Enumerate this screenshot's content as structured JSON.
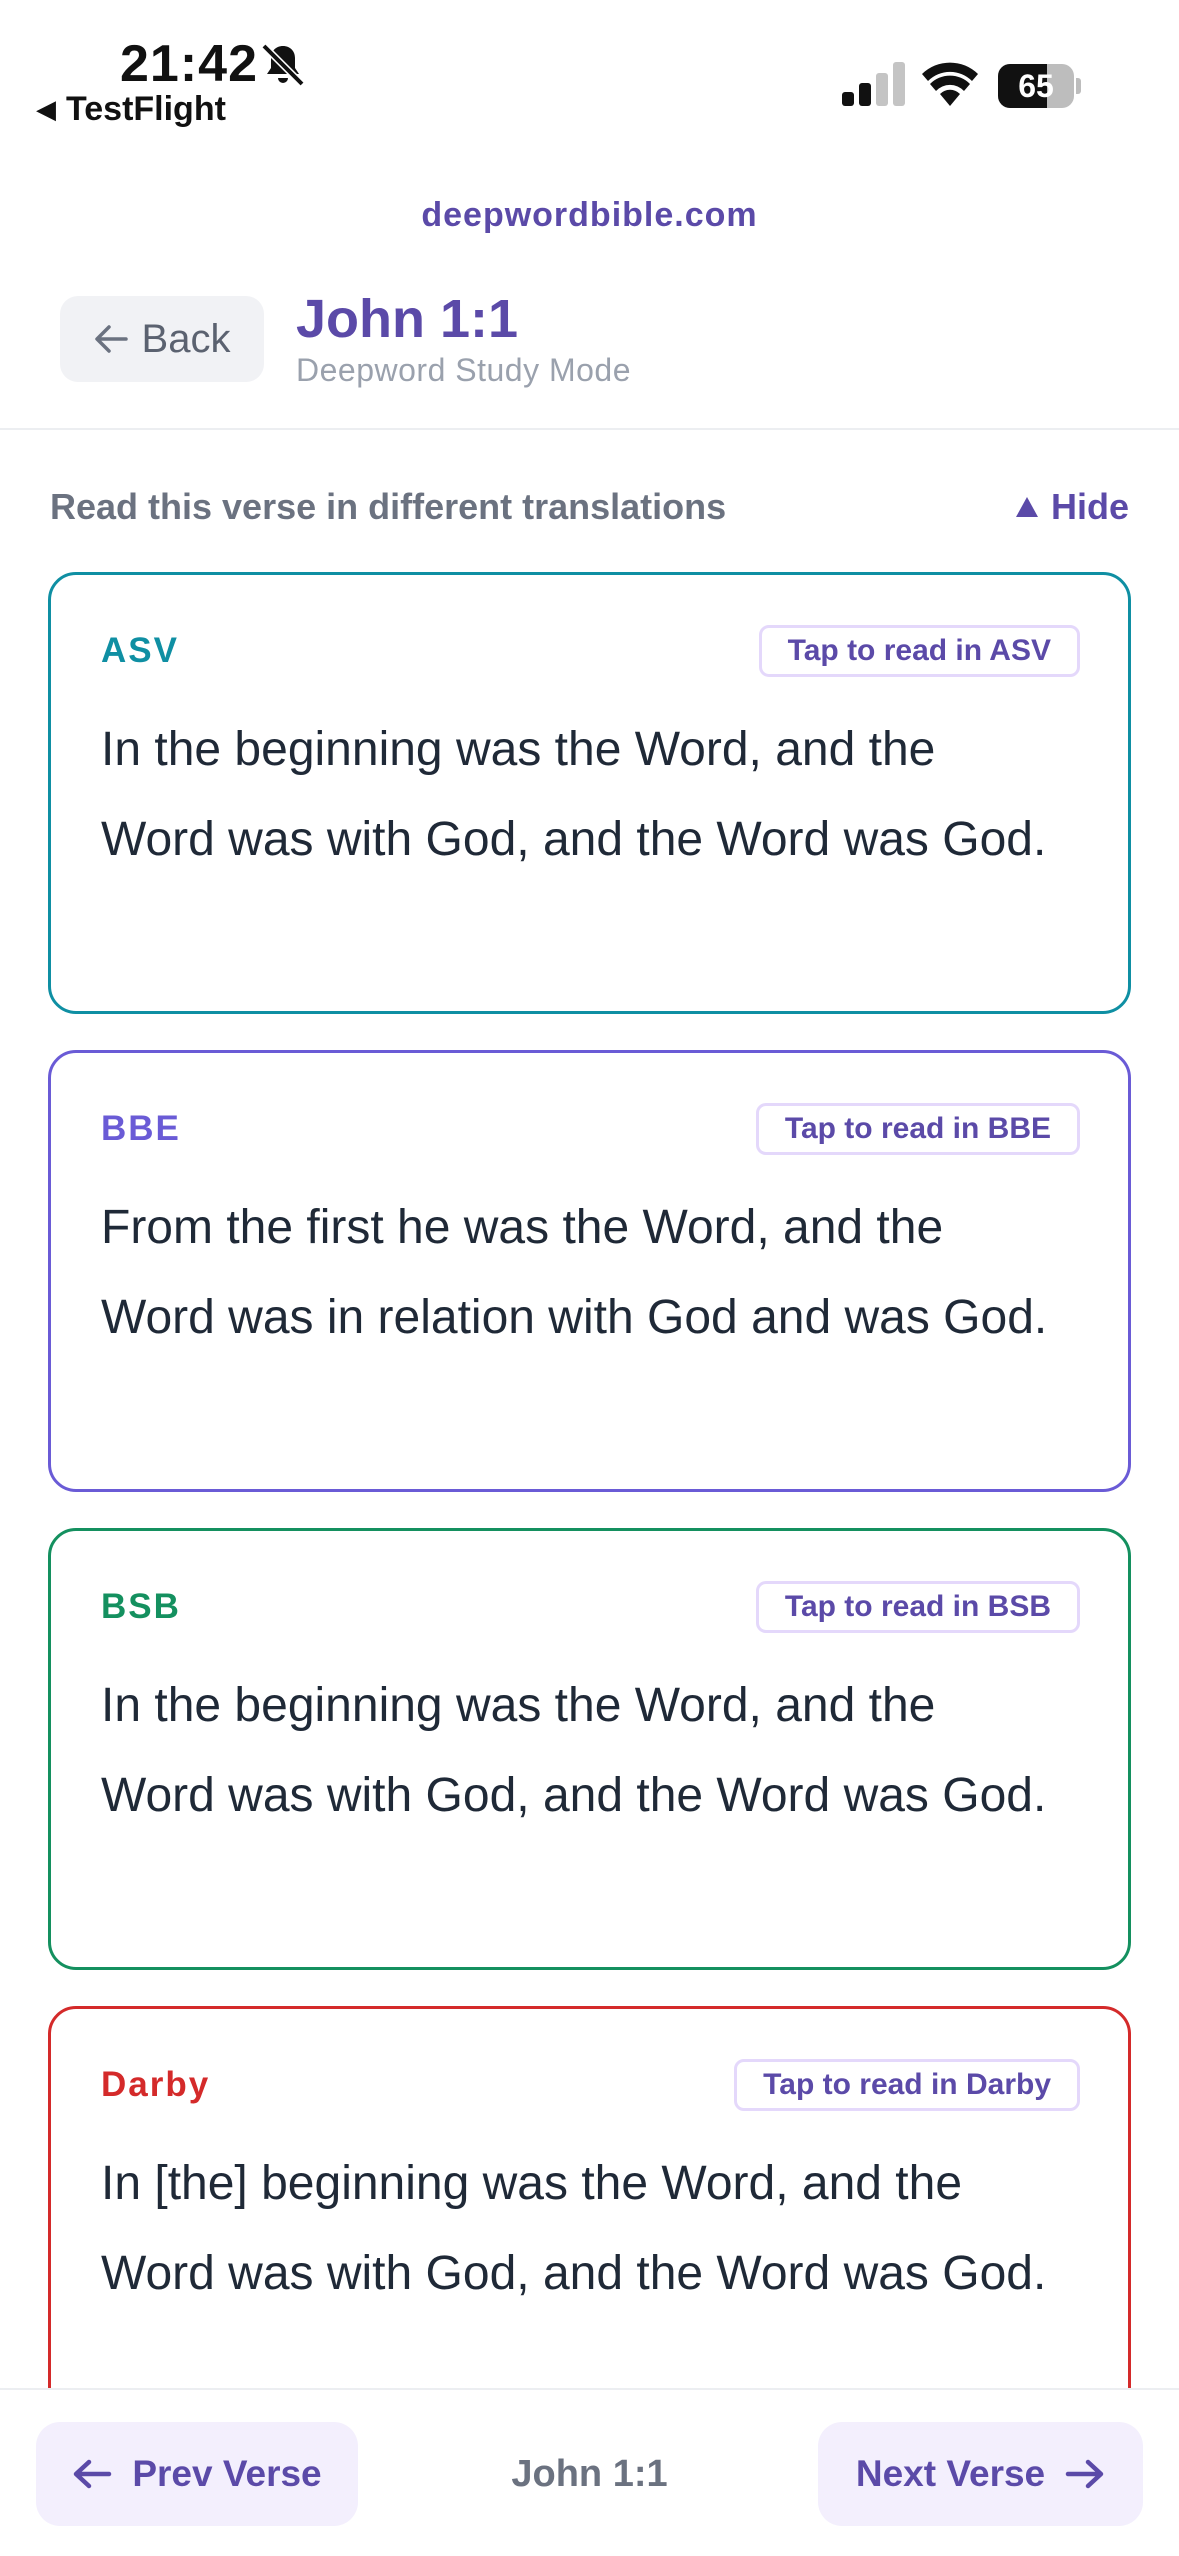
{
  "status_bar": {
    "time": "21:42",
    "back_app": "TestFlight",
    "battery_percent": 65
  },
  "header": {
    "domain": "deepwordbible.com",
    "back_label": "Back",
    "verse_title": "John 1:1",
    "subtitle": "Deepword Study Mode"
  },
  "translations_section": {
    "heading": "Read this verse in different translations",
    "toggle_label": "Hide",
    "cards": [
      {
        "code": "ASV",
        "tap_label": "Tap to read in ASV",
        "text": "In the beginning was the Word, and the Word was with God, and the Word was God.",
        "color": "#0f8fa3"
      },
      {
        "code": "BBE",
        "tap_label": "Tap to read in BBE",
        "text": "From the first he was the Word, and the Word was in relation with God and was God.",
        "color": "#6a5bd6"
      },
      {
        "code": "BSB",
        "tap_label": "Tap to read in BSB",
        "text": "In the beginning was the Word, and the Word was with God, and the Word was God.",
        "color": "#14905f"
      },
      {
        "code": "Darby",
        "tap_label": "Tap to read in Darby",
        "text": "In [the] beginning was the Word, and the Word was with God, and the Word was God.",
        "color": "#d42a2a"
      }
    ]
  },
  "bottom_nav": {
    "prev_label": "Prev Verse",
    "reference": "John 1:1",
    "next_label": "Next Verse"
  },
  "colors": {
    "accent": "#5b4aa8",
    "tap_border": "#e4d8fb",
    "nav_bg": "#f3effd"
  }
}
